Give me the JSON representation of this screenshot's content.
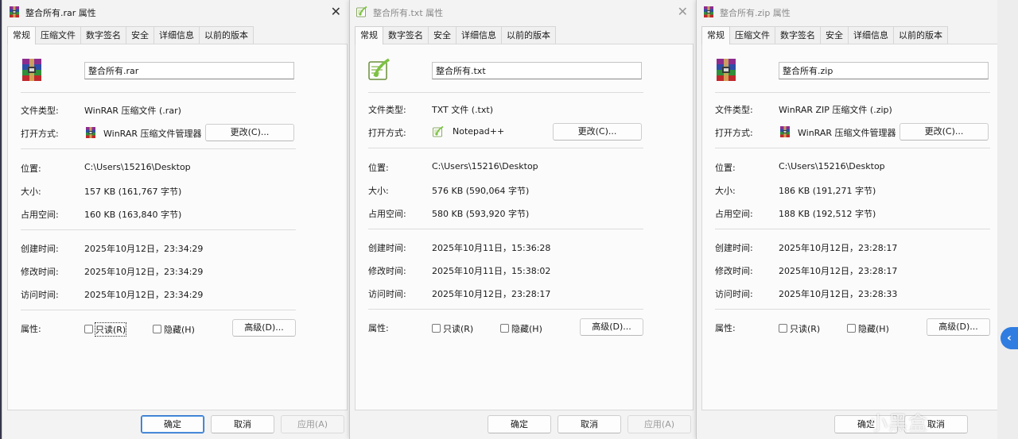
{
  "watermark": "小黑盒",
  "side_tab_glyph": "‹",
  "labels": {
    "type": "文件类型:",
    "open_with": "打开方式:",
    "location": "位置:",
    "size": "大小:",
    "size_on_disk": "占用空间:",
    "created": "创建时间:",
    "modified": "修改时间:",
    "accessed": "访问时间:",
    "attributes": "属性:"
  },
  "buttons": {
    "change": "更改(C)...",
    "advanced": "高级(D)...",
    "readonly": "只读(R)",
    "hidden": "隐藏(H)",
    "ok": "确定",
    "cancel": "取消",
    "apply": "应用(A)"
  },
  "dialogs": [
    {
      "title": "整合所有.rar 属性",
      "icon": "winrar-archive-icon",
      "tabs": [
        "常规",
        "压缩文件",
        "数字签名",
        "安全",
        "详细信息",
        "以前的版本"
      ],
      "active_tab": "常规",
      "filename": "整合所有.rar",
      "type": "WinRAR 压缩文件 (.rar)",
      "open_with": "WinRAR 压缩文件管理器",
      "location": "C:\\Users\\15216\\Desktop",
      "size": "157 KB (161,767 字节)",
      "size_on_disk": "160 KB (163,840 字节)",
      "created": "2025年10月12日，23:34:29",
      "modified": "2025年10月12日，23:34:29",
      "accessed": "2025年10月12日，23:34:29"
    },
    {
      "title": "整合所有.txt 属性",
      "icon": "notepadpp-icon",
      "tabs": [
        "常规",
        "数字签名",
        "安全",
        "详细信息",
        "以前的版本"
      ],
      "active_tab": "常规",
      "filename": "整合所有.txt",
      "type": "TXT 文件 (.txt)",
      "open_with": "Notepad++",
      "location": "C:\\Users\\15216\\Desktop",
      "size": "576 KB (590,064 字节)",
      "size_on_disk": "580 KB (593,920 字节)",
      "created": "2025年10月11日，15:36:28",
      "modified": "2025年10月11日，15:38:02",
      "accessed": "2025年10月12日，23:28:17"
    },
    {
      "title": "整合所有.zip 属性",
      "icon": "winrar-archive-icon",
      "tabs": [
        "常规",
        "压缩文件",
        "数字签名",
        "安全",
        "详细信息",
        "以前的版本"
      ],
      "active_tab": "常规",
      "filename": "整合所有.zip",
      "type": "WinRAR ZIP 压缩文件 (.zip)",
      "open_with": "WinRAR 压缩文件管理器",
      "location": "C:\\Users\\15216\\Desktop",
      "size": "186 KB (191,271 字节)",
      "size_on_disk": "188 KB (192,512 字节)",
      "created": "2025年10月12日，23:28:17",
      "modified": "2025年10月12日，23:28:17",
      "accessed": "2025年10月12日，23:28:33"
    }
  ],
  "colors": {
    "accent": "#2a70c8",
    "side_tab": "#2f7de1",
    "winrar_red": "#c0282d",
    "winrar_blue": "#2e4ea8",
    "notepadpp_green": "#7cc242"
  }
}
